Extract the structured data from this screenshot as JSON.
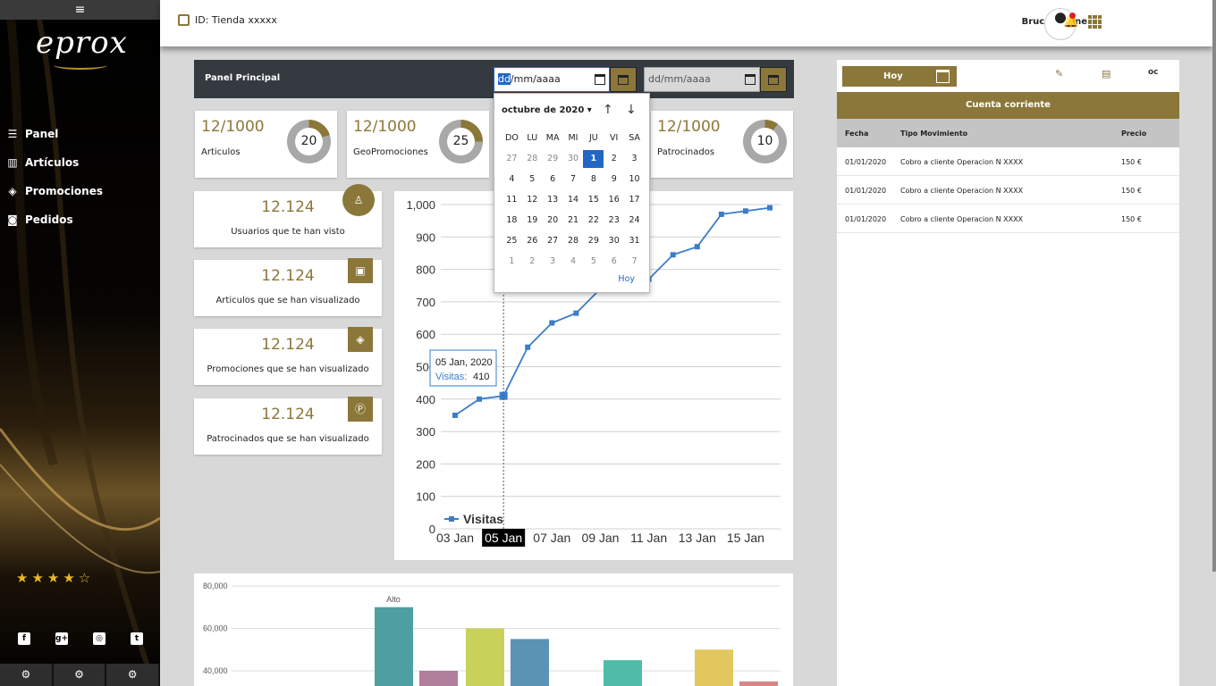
{
  "sidebar": {
    "menu_icon": "≡",
    "logo": "eprox",
    "items": [
      {
        "label": "Panel",
        "icon": "list-icon"
      },
      {
        "label": "Artículos",
        "icon": "barcode-icon"
      },
      {
        "label": "Promociones",
        "icon": "tag-icon"
      },
      {
        "label": "Pedidos",
        "icon": "bag-icon"
      }
    ],
    "rating": 4,
    "rating_max": 5,
    "stars_text": "★★★★☆",
    "social": [
      "f",
      "g+",
      "◎",
      "t"
    ],
    "bottom_buttons": [
      "⚙",
      "⚙",
      "⚙"
    ]
  },
  "topbar": {
    "store_id": "ID: Tienda xxxxx",
    "user_name": "Bruce Wayne"
  },
  "panel": {
    "title": "Panel Principal",
    "date_from": {
      "dd": "dd",
      "rest": "/mm/aaaa"
    },
    "date_to": "dd/mm/aaaa"
  },
  "kpis": [
    {
      "value": "12/1000",
      "label": "Articulos",
      "pct": "20",
      "fraction": 0.2
    },
    {
      "value": "12/1000",
      "label": "GeoPromociones",
      "pct": "25",
      "fraction": 0.25
    },
    {
      "value": "12/1000",
      "label": "Patrocinados",
      "pct": "10",
      "fraction": 0.1
    }
  ],
  "stats": [
    {
      "value": "12.124",
      "label": "Usuarios que te han visto",
      "icon": "person-icon"
    },
    {
      "value": "12.124",
      "label": "Articulos que se han visualizado",
      "icon": "box-icon"
    },
    {
      "value": "12.124",
      "label": "Promociones que se han visualizado",
      "icon": "tag-icon"
    },
    {
      "value": "12.124",
      "label": "Patrocinados que se han visualizado",
      "icon": "sponsor-icon"
    }
  ],
  "calendar": {
    "month_label": "octubre de 2020 ▾",
    "up": "↑",
    "down": "↓",
    "weekdays": [
      "DO",
      "LU",
      "MA",
      "MI",
      "JU",
      "VI",
      "SA"
    ],
    "days": [
      "27",
      "28",
      "29",
      "30",
      "1",
      "2",
      "3",
      "4",
      "5",
      "6",
      "7",
      "8",
      "9",
      "10",
      "11",
      "12",
      "13",
      "14",
      "15",
      "16",
      "17",
      "18",
      "19",
      "20",
      "21",
      "22",
      "23",
      "24",
      "25",
      "26",
      "27",
      "28",
      "29",
      "30",
      "31",
      "1",
      "2",
      "3",
      "4",
      "5",
      "6",
      "7"
    ],
    "selected": "1",
    "today_label": "Hoy"
  },
  "chart_data": [
    {
      "type": "line",
      "x": [
        "03 Jan",
        "04 Jan",
        "05 Jan",
        "06 Jan",
        "07 Jan",
        "08 Jan",
        "09 Jan",
        "10 Jan",
        "11 Jan",
        "12 Jan",
        "13 Jan",
        "14 Jan",
        "15 Jan",
        "16 Jan"
      ],
      "x_tick_labels": [
        "03 Jan",
        "05 Jan",
        "07 Jan",
        "09 Jan",
        "11 Jan",
        "13 Jan",
        "15 Jan"
      ],
      "series": [
        {
          "name": "Visitas",
          "values": [
            350,
            400,
            410,
            560,
            635,
            665,
            740,
            775,
            770,
            845,
            870,
            970,
            980,
            990
          ]
        }
      ],
      "ylim": [
        0,
        1000
      ],
      "yticks": [
        "0",
        "100",
        "200",
        "300",
        "400",
        "500",
        "600",
        "700",
        "800",
        "900",
        "1,000"
      ],
      "tooltip": {
        "date": "05 Jan, 2020",
        "series": "Visitas:",
        "value": "410"
      },
      "legend": "bottom-left",
      "color": "#3a7dc9"
    },
    {
      "type": "bar",
      "yticks": [
        "40,000",
        "60,000",
        "80,000"
      ],
      "values": [
        70000,
        40000,
        60000,
        55000,
        45000,
        50000,
        35000
      ],
      "colors": [
        "#4e9fa2",
        "#b07d9a",
        "#c8d25a",
        "#5b93b5",
        "#4fbba8",
        "#e2c75e",
        "#d88585"
      ],
      "annotation": "Alto",
      "ylim": [
        30000,
        80000
      ]
    }
  ],
  "right": {
    "hoy": "Hoy",
    "title": "Cuenta corriente",
    "columns": [
      "Fecha",
      "Tipo Movimiento",
      "Precio"
    ],
    "rows": [
      [
        "01/01/2020",
        "Cobro a cliente Operacion N XXXX",
        "150 €"
      ],
      [
        "01/01/2020",
        "Cobro a cliente Operacion N XXXX",
        "150 €"
      ],
      [
        "01/01/2020",
        "Cobro a cliente Operacion N XXXX",
        "150 €"
      ]
    ],
    "tab_icons": [
      "notepad-icon",
      "document-icon",
      "oc"
    ]
  },
  "colors": {
    "accent": "#8b7739",
    "dark": "#343a40",
    "line": "#3a7dc9"
  }
}
